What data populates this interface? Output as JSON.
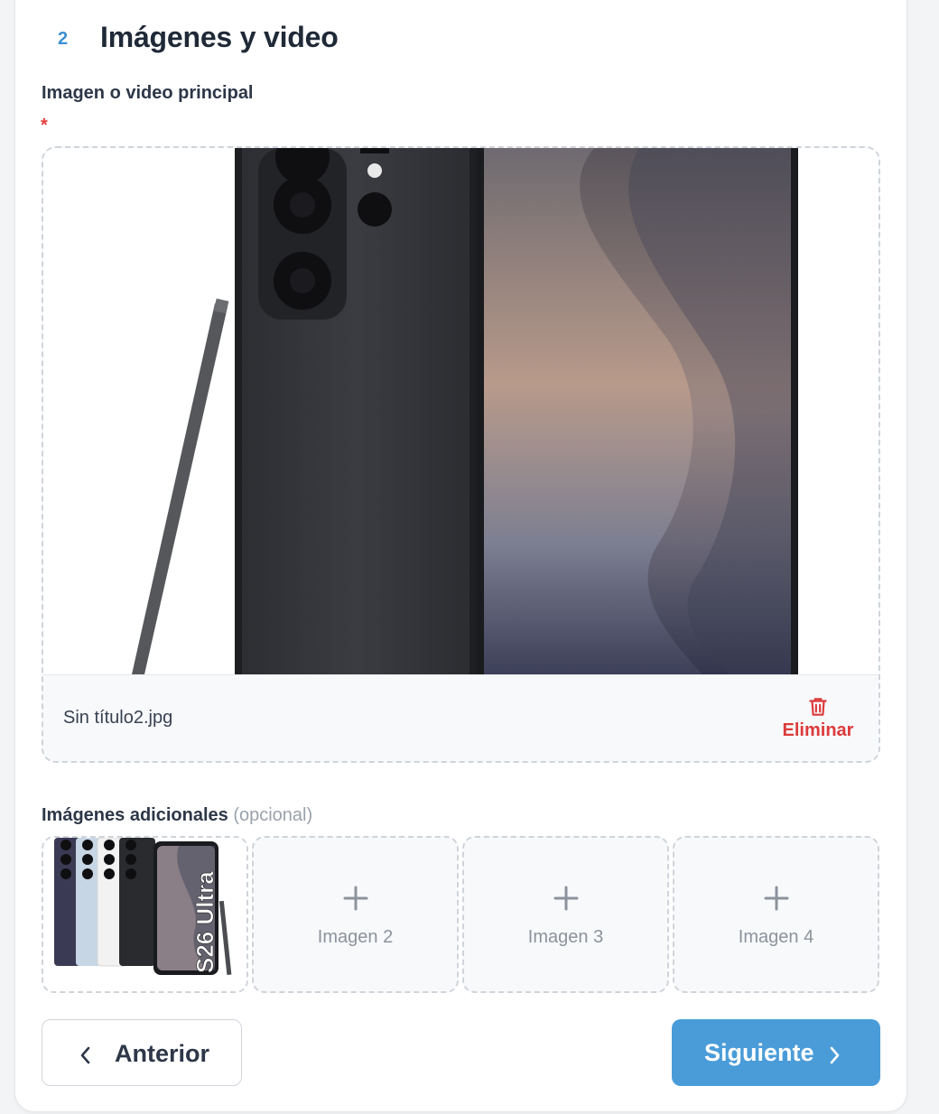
{
  "section": {
    "step_number": "2",
    "title": "Imágenes y video"
  },
  "main_media": {
    "label": "Imagen o video principal",
    "required_mark": "*",
    "file_name": "Sin título2.jpg",
    "delete_label": "Eliminar",
    "preview_icon": "phone-product-image"
  },
  "additional": {
    "label": "Imágenes adicionales",
    "optional_label": "(opcional)",
    "thumbnail_text": "S26 Ultra",
    "slots": [
      {
        "label": "Imagen 2"
      },
      {
        "label": "Imagen 3"
      },
      {
        "label": "Imagen 4"
      }
    ]
  },
  "nav": {
    "prev_label": "Anterior",
    "next_label": "Siguiente"
  },
  "colors": {
    "accent": "#4a9cd8",
    "danger": "#dc3b3b",
    "required": "#e53e3e"
  }
}
